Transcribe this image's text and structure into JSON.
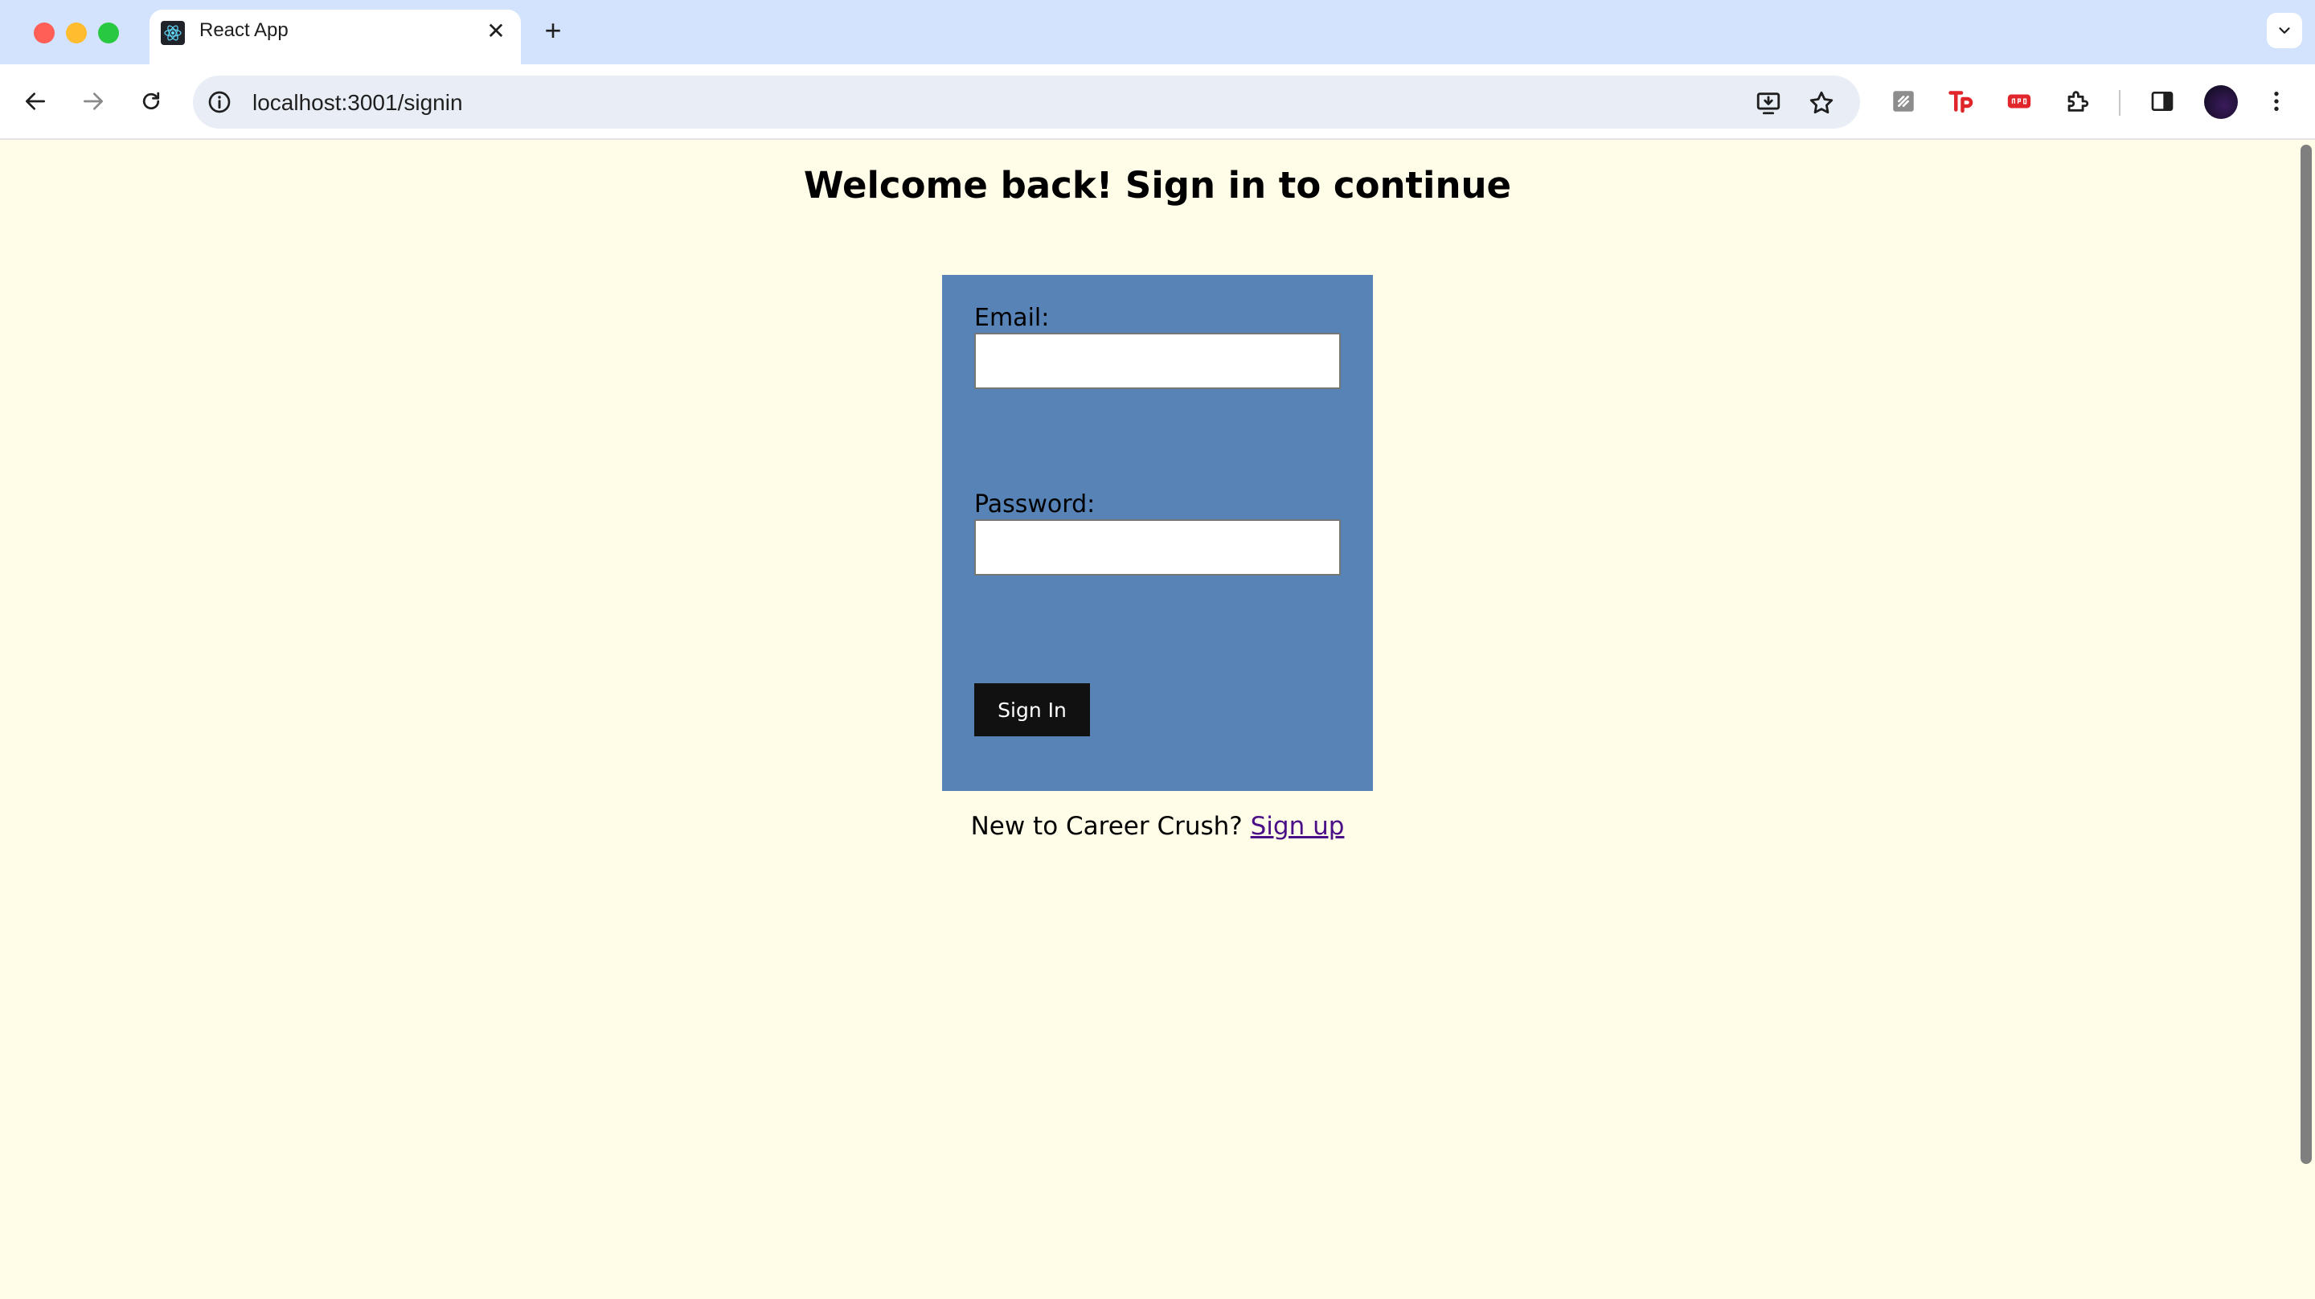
{
  "browser": {
    "tab_title": "React App",
    "tab_close_glyph": "✕",
    "new_tab_glyph": "+",
    "url": "localhost:3001/signin",
    "icons": [
      "back-icon",
      "forward-icon",
      "reload-icon",
      "site-info-icon",
      "install-icon",
      "bookmark-star-icon",
      "extension-icon",
      "side-panel-icon",
      "menu-icon"
    ]
  },
  "page": {
    "title": "Welcome back! Sign in to continue",
    "email_label": "Email:",
    "email_value": "",
    "password_label": "Password:",
    "password_value": "",
    "signin_label": "Sign In",
    "footer_text": "New to Career Crush? ",
    "signup_link": "Sign up",
    "colors": {
      "background": "#fffde8",
      "card": "#5883b7",
      "button": "#111111",
      "link": "#4b0f87"
    }
  }
}
